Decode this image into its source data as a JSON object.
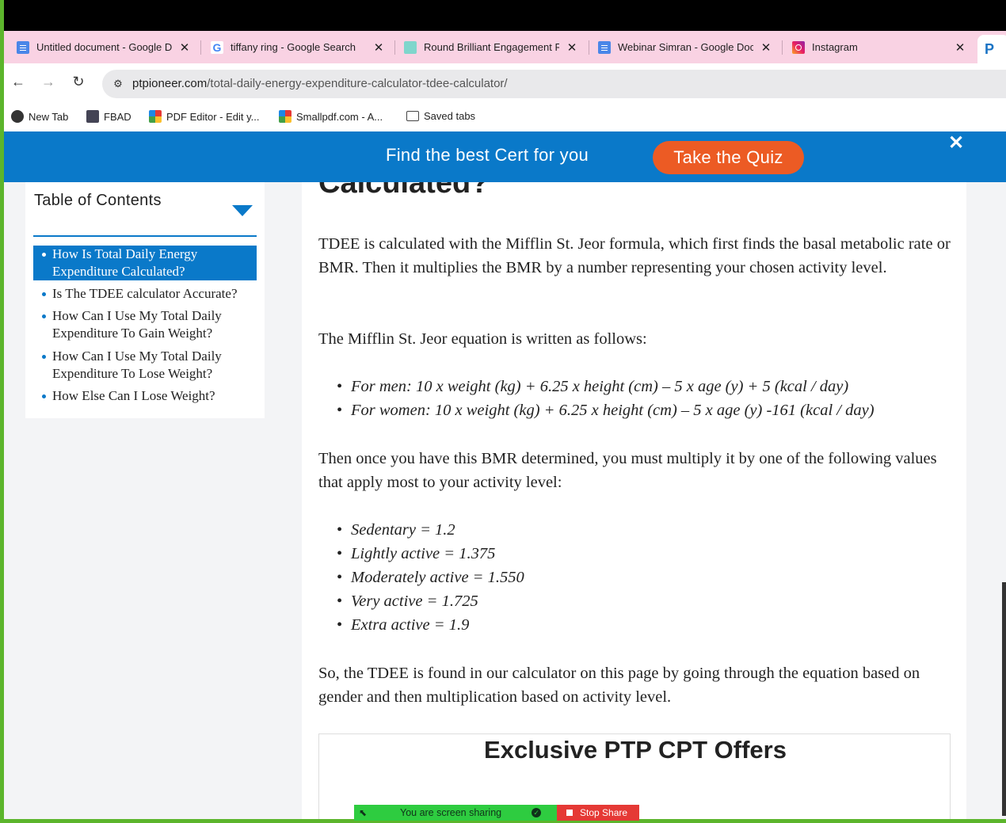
{
  "browser": {
    "tabs": [
      {
        "title": "Untitled document - Google Docs",
        "icon": "google-docs-icon"
      },
      {
        "title": "tiffany ring - Google Search",
        "icon": "google-icon"
      },
      {
        "title": "Round Brilliant Engagement Ring",
        "icon": "teal-square-icon"
      },
      {
        "title": "Webinar Simran - Google Docs",
        "icon": "google-docs-icon"
      },
      {
        "title": "Instagram",
        "icon": "instagram-icon"
      }
    ],
    "url_domain": "ptpioneer.com",
    "url_path": "/total-daily-energy-expenditure-calculator-tdee-calculator/",
    "bookmarks": [
      {
        "label": "New Tab",
        "icon": "globe-icon"
      },
      {
        "label": "FBAD",
        "icon": "save-icon"
      },
      {
        "label": "PDF Editor - Edit y...",
        "icon": "multicolor-icon"
      },
      {
        "label": "Smallpdf.com - A...",
        "icon": "multicolor-icon"
      },
      {
        "label": "Saved tabs",
        "icon": "folder-icon"
      }
    ]
  },
  "banner": {
    "text": "Find the best Cert for you",
    "button": "Take the Quiz",
    "close": "✕"
  },
  "toc": {
    "title": "Table of Contents",
    "items": [
      {
        "label": "How Is Total Daily Energy Expenditure Calculated?",
        "active": true
      },
      {
        "label": "Is The TDEE calculator Accurate?",
        "active": false
      },
      {
        "label": "How Can I Use My Total Daily Expenditure To Gain Weight?",
        "active": false
      },
      {
        "label": "How Can I Use My Total Daily Expenditure To Lose Weight?",
        "active": false
      },
      {
        "label": "How Else Can I Lose Weight?",
        "active": false
      }
    ]
  },
  "article": {
    "heading": "Calculated?",
    "p1": "TDEE is calculated with the Mifflin St. Jeor formula, which first finds the basal metabolic rate or BMR. Then it multiplies the BMR by a number representing your chosen activity level.",
    "p2": "The Mifflin St. Jeor equation is written as follows:",
    "formulas": [
      "For men: 10 x weight (kg) + 6.25 x height (cm) – 5 x age (y) + 5 (kcal / day)",
      "For women: 10 x weight (kg) + 6.25 x height (cm) – 5 x age (y) -161 (kcal / day)"
    ],
    "p3": "Then once you have this BMR determined, you must multiply it by one of the following values that apply most to your activity level:",
    "activity_levels": [
      "Sedentary = 1.2",
      "Lightly active = 1.375",
      "Moderately active = 1.550",
      "Very active = 1.725",
      "Extra active = 1.9"
    ],
    "p4": "So, the TDEE is found in our calculator on this page by going through the equation based on gender and then multiplication based on activity level.",
    "offers_title": "Exclusive PTP CPT Offers"
  },
  "screen_share": {
    "status": "You are screen sharing",
    "stop": "Stop Share"
  },
  "colors": {
    "accent_blue": "#0a79c9",
    "quiz_orange": "#ec5b24",
    "tab_strip_pink": "#f9d2e3",
    "share_green": "#2ecc40",
    "stop_red": "#e53935"
  }
}
